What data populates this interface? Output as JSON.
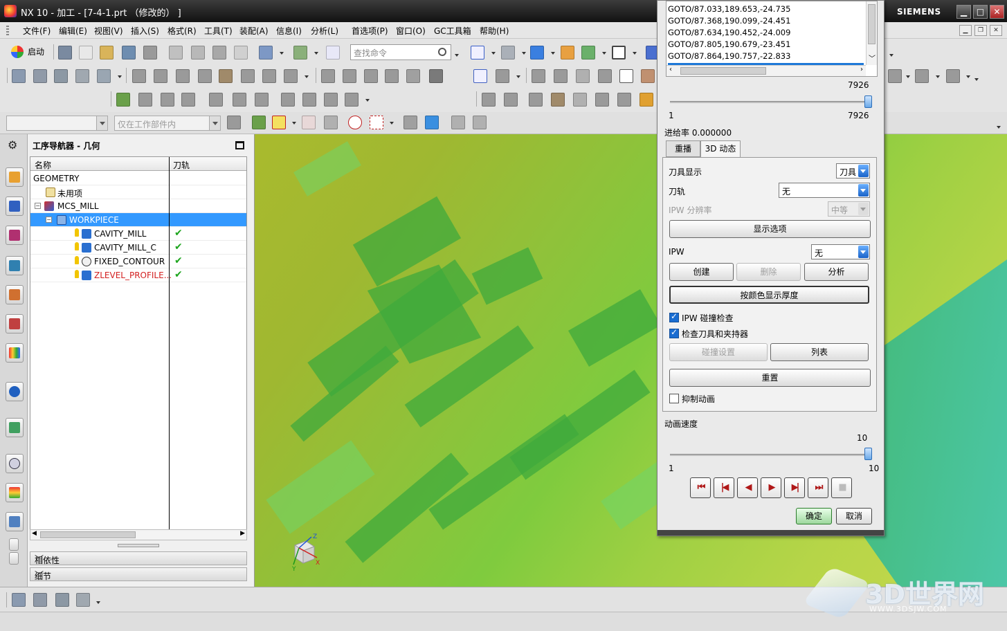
{
  "window": {
    "title": "NX 10 - 加工 - [7-4-1.prt （修改的） ]",
    "brand": "SIEMENS",
    "controls": {
      "minimize": "▁",
      "maximize": "□",
      "close": "✕"
    }
  },
  "menu": {
    "items": [
      "文件(F)",
      "编辑(E)",
      "视图(V)",
      "插入(S)",
      "格式(R)",
      "工具(T)",
      "装配(A)",
      "信息(I)",
      "分析(L)",
      "首选项(P)",
      "窗口(O)",
      "GC工具箱",
      "帮助(H)"
    ]
  },
  "toolbar": {
    "start_label": "启动",
    "search_placeholder": "查找命令"
  },
  "selection_bar": {
    "filter_value": "",
    "scope_value": "仅在工作部件内"
  },
  "navigator": {
    "title": "工序导航器 - 几何",
    "columns": [
      "名称",
      "刀轨"
    ],
    "rows": [
      {
        "label": "GEOMETRY",
        "toolpath": "",
        "selected": false
      },
      {
        "label": "未用项",
        "toolpath": "",
        "selected": false
      },
      {
        "label": "MCS_MILL",
        "toolpath": "",
        "selected": false
      },
      {
        "label": "WORKPIECE",
        "toolpath": "",
        "selected": true
      },
      {
        "label": "CAVITY_MILL",
        "toolpath": "✔",
        "selected": false
      },
      {
        "label": "CAVITY_MILL_C",
        "toolpath": "✔",
        "selected": false
      },
      {
        "label": "FIXED_CONTOUR",
        "toolpath": "✔",
        "selected": false
      },
      {
        "label": "ZLEVEL_PROFILE...",
        "toolpath": "✔",
        "selected": false
      }
    ],
    "panels": [
      "相依性",
      "细节"
    ],
    "highlight_color": "#3399ff",
    "warning_color": "#d32020"
  },
  "dialog": {
    "goto_lines": [
      "GOTO/87.033,189.653,-24.735",
      "GOTO/87.368,190.099,-24.451",
      "GOTO/87.634,190.452,-24.009",
      "GOTO/87.805,190.679,-23.451",
      "GOTO/87.864,190.757,-22.833"
    ],
    "step_slider": {
      "value": "7926",
      "min": "1",
      "max": "7926"
    },
    "feed_label": "进给率 0.000000",
    "tabs": [
      "重播",
      "3D 动态"
    ],
    "active_tab": "3D 动态",
    "tool_display_label": "刀具显示",
    "tool_display_value": "刀具",
    "toolpath_label": "刀轨",
    "toolpath_value": "无",
    "ipw_res_label": "IPW 分辨率",
    "ipw_res_value": "中等",
    "display_options_btn": "显示选项",
    "ipw_label": "IPW",
    "ipw_value": "无",
    "create_btn": "创建",
    "delete_btn": "删除",
    "analyze_btn": "分析",
    "thickness_btn": "按颜色显示厚度",
    "ipw_collision_label": "IPW 碰撞检查",
    "check_tool_label": "检查刀具和夹持器",
    "collision_settings_btn": "碰撞设置",
    "list_btn": "列表",
    "reset_btn": "重置",
    "suppress_anim_label": "抑制动画",
    "anim_speed_label": "动画速度",
    "speed_slider": {
      "value": "10",
      "min": "1",
      "max": "10"
    },
    "playback": [
      "⏮",
      "|◀",
      "◀",
      "▶",
      "▶|",
      "⏭",
      "■"
    ],
    "ok_btn": "确定",
    "cancel_btn": "取消",
    "checks": {
      "ipw_collision": true,
      "check_tool": true,
      "suppress_anim": false
    }
  },
  "viewport": {
    "triad_labels": {
      "z": "Z",
      "y": "Y",
      "x": "X"
    }
  },
  "watermark": {
    "text": "3D世界网",
    "url": "WWW.3DSJW.COM"
  }
}
